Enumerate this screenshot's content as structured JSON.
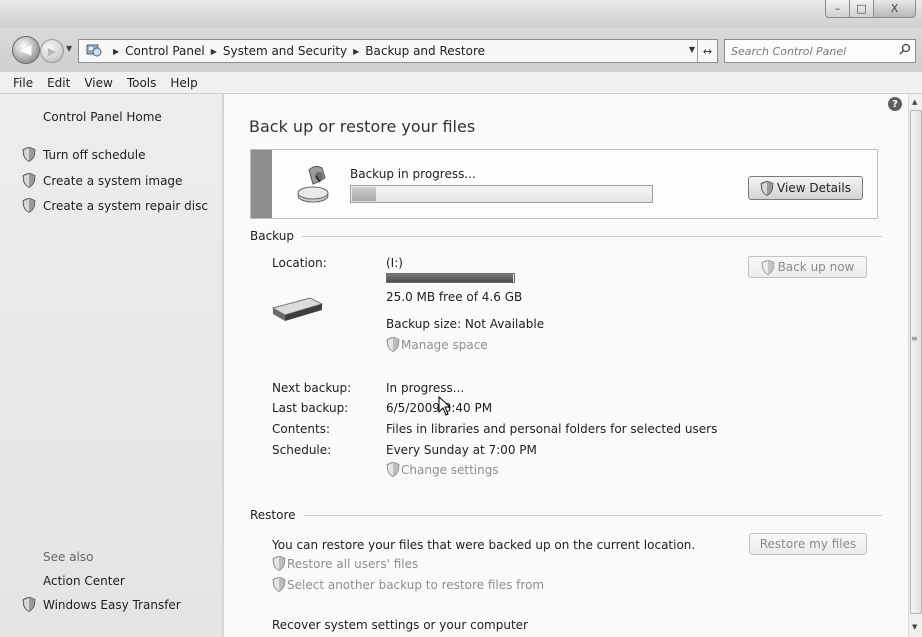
{
  "window": {
    "controls": {
      "minimize": "–",
      "maximize": "□",
      "close": "X"
    }
  },
  "nav": {
    "back_glyph": "◀",
    "forward_glyph": "▶",
    "history_glyph": "▼",
    "breadcrumb": [
      "Control Panel",
      "System and Security",
      "Backup and Restore"
    ],
    "breadcrumb_sep": "▶",
    "dropdown_glyph": "▼",
    "refresh_glyph": "↔",
    "search_placeholder": "Search Control Panel"
  },
  "menu": [
    "File",
    "Edit",
    "View",
    "Tools",
    "Help"
  ],
  "sidebar": {
    "home": "Control Panel Home",
    "tasks": [
      "Turn off schedule",
      "Create a system image",
      "Create a system repair disc"
    ],
    "see_also": "See also",
    "action_center": "Action Center",
    "easy_transfer": "Windows Easy Transfer"
  },
  "main": {
    "title": "Back up or restore your files",
    "progress": {
      "label": "Backup in progress...",
      "fraction": 0.08,
      "button": "View Details"
    },
    "backup": {
      "header": "Backup",
      "location_label": "Location:",
      "location_value": "(I:)",
      "drive_used_fraction": 0.99,
      "free_space": "25.0 MB free of 4.6 GB",
      "backup_size": "Backup size: Not Available",
      "manage_space": "Manage space",
      "backup_now": "Back up now",
      "next_label": "Next backup:",
      "next_value": "In progress...",
      "last_label": "Last backup:",
      "last_value": "6/5/2009 3:40 PM",
      "contents_label": "Contents:",
      "contents_value": "Files in libraries and personal folders for selected users",
      "schedule_label": "Schedule:",
      "schedule_value": "Every Sunday at 7:00 PM",
      "change_settings": "Change settings"
    },
    "restore": {
      "header": "Restore",
      "description": "You can restore your files that were backed up on the current location.",
      "restore_all": "Restore all users' files",
      "select_another": "Select another backup to restore files from",
      "restore_button": "Restore my files",
      "recover": "Recover system settings or your computer"
    }
  },
  "help_glyph": "?",
  "scroll": {
    "up": "▲",
    "down": "▼",
    "grip": "≡"
  }
}
